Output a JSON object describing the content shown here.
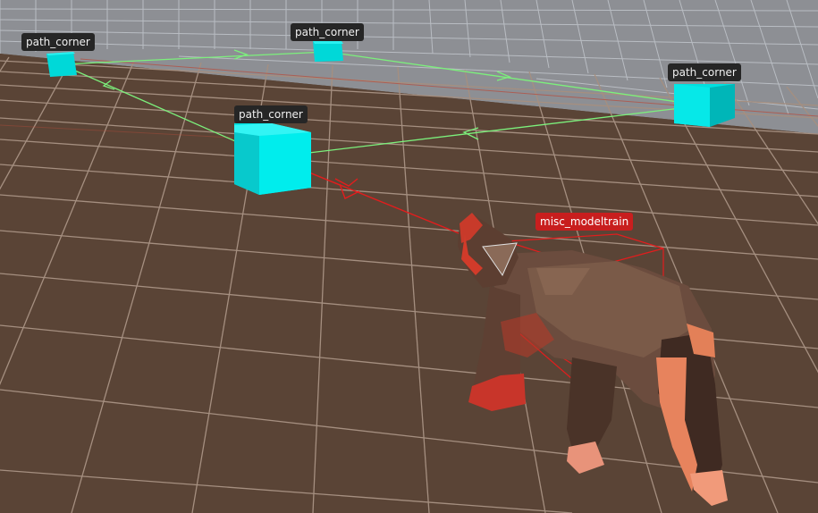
{
  "viewport": {
    "background_color": "#5a4436",
    "wall_color": "#8d8f94",
    "floor_grid_color": "#a58f80",
    "wall_grid_color": "#b8bcc2",
    "path_line_color": "#7cf07c",
    "selection_color": "#e21d1d",
    "path_corner_color": "#00e0e0"
  },
  "entities": {
    "path_corner_1": {
      "label": "path_corner",
      "icon": "cube-icon"
    },
    "path_corner_2": {
      "label": "path_corner",
      "icon": "cube-icon"
    },
    "path_corner_3": {
      "label": "path_corner",
      "icon": "cube-icon"
    },
    "path_corner_4": {
      "label": "path_corner",
      "icon": "cube-icon"
    },
    "modeltrain": {
      "label": "misc_modeltrain",
      "model": "cat-model"
    }
  }
}
